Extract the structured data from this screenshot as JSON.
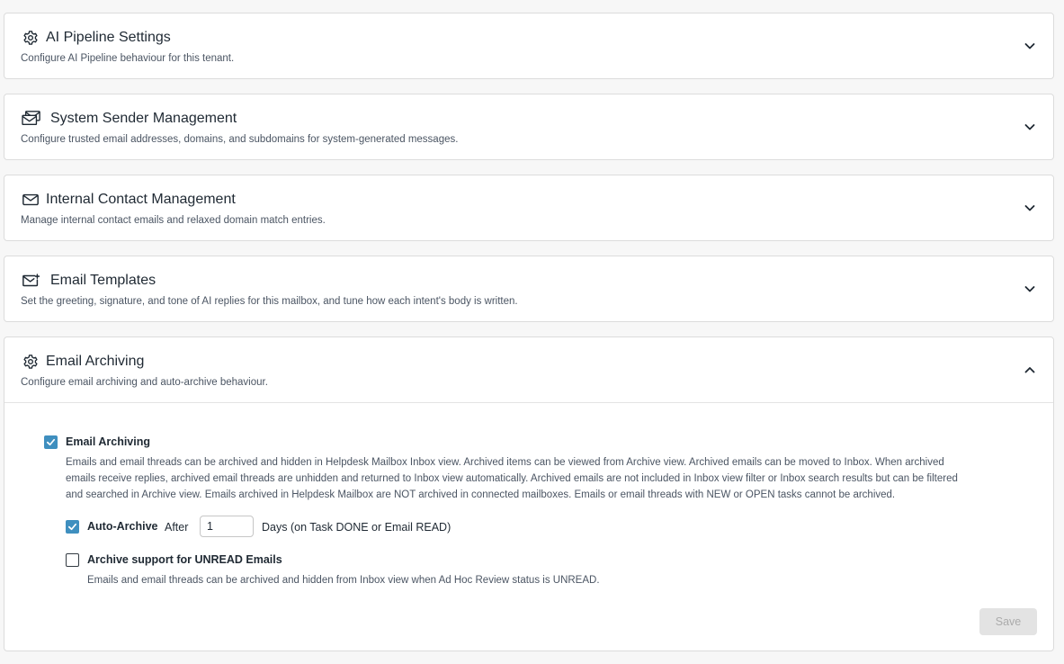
{
  "panels": [
    {
      "title": "AI Pipeline Settings",
      "description": "Configure AI Pipeline behaviour for this tenant.",
      "icon": "gear-icon",
      "expanded": false
    },
    {
      "title": "System Sender Management",
      "description": "Configure trusted email addresses, domains, and subdomains for system-generated messages.",
      "icon": "mail-stack-icon",
      "expanded": false
    },
    {
      "title": "Internal Contact Management",
      "description": "Manage internal contact emails and relaxed domain match entries.",
      "icon": "envelope-icon",
      "expanded": false
    },
    {
      "title": "Email Templates",
      "description": "Set the greeting, signature, and tone of AI replies for this mailbox, and tune how each intent's body is written.",
      "icon": "envelope-edit-icon",
      "expanded": false
    },
    {
      "title": "Email Archiving",
      "description": "Configure email archiving and auto-archive behaviour.",
      "icon": "gear-icon",
      "expanded": true
    }
  ],
  "archiving": {
    "enable_label": "Email Archiving",
    "enable_checked": true,
    "enable_desc_1": "Emails and email threads can be archived and hidden in Helpdesk Mailbox Inbox view. Archived items can be viewed from Archive view. Archived emails can be moved to Inbox. When archived",
    "enable_desc_2": "emails receive replies, archived email threads are unhidden and returned to Inbox view automatically. Archived emails are not included in Inbox view filter or Inbox search results but can be filtered",
    "enable_desc_3": "and searched in Archive view. Emails archived in Helpdesk Mailbox are NOT archived in connected mailboxes. Emails or email threads with NEW or OPEN tasks cannot be archived.",
    "auto_label": "Auto-Archive",
    "auto_checked": true,
    "after_text": "After",
    "days_value": "1",
    "days_suffix": "Days (on Task DONE or Email READ)",
    "unread_label": "Archive support for UNREAD Emails",
    "unread_checked": false,
    "unread_desc": "Emails and email threads can be archived and hidden from Inbox view when Ad Hoc Review status is UNREAD.",
    "save_label": "Save"
  },
  "colors": {
    "checkbox_accent": "#3f8fbf",
    "disabled_button_bg": "#e3e3e3"
  }
}
